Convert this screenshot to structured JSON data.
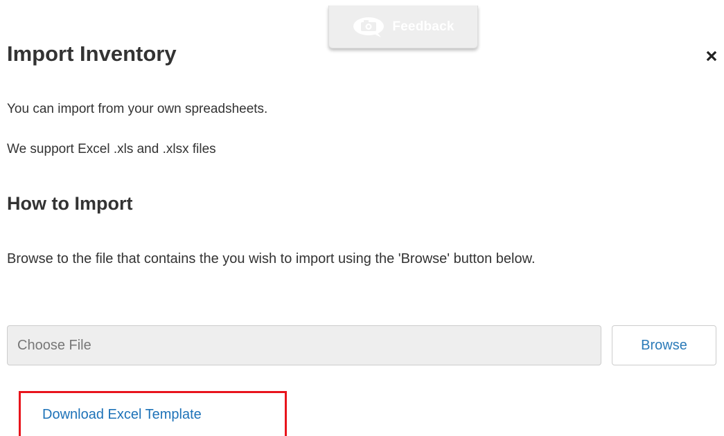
{
  "feedback_tab": {
    "label": "Feedback",
    "icon": "camera-speech-bubble-icon"
  },
  "modal": {
    "title": "Import Inventory",
    "close_icon": "close-icon"
  },
  "intro": {
    "line1": "You can import from your own spreadsheets.",
    "line2": "We support Excel .xls and .xlsx files"
  },
  "how_to": {
    "heading": "How to Import",
    "instructions": "Browse to the file that contains the you wish to import using the 'Browse' button below."
  },
  "file_picker": {
    "placeholder": "Choose File",
    "value": "",
    "browse_label": "Browse"
  },
  "download": {
    "label": "Download Excel Template",
    "highlight_color": "#e8141c"
  },
  "colors": {
    "link": "#1d72b8",
    "text": "#333333",
    "input_bg": "#eeeeee"
  }
}
